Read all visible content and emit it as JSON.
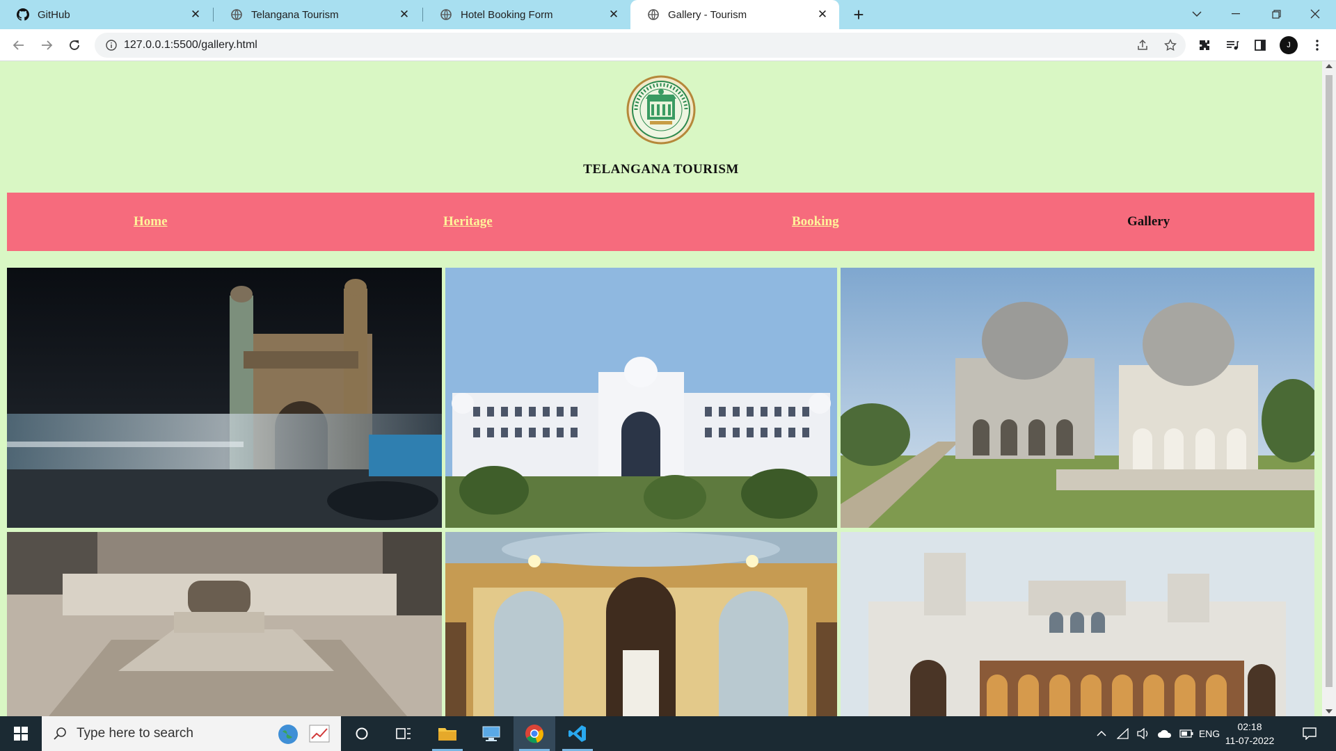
{
  "browser": {
    "tabs": [
      {
        "title": "GitHub",
        "favicon": "github-icon",
        "active": false
      },
      {
        "title": "Telangana Tourism",
        "favicon": "globe-icon",
        "active": false
      },
      {
        "title": "Hotel Booking Form",
        "favicon": "globe-icon",
        "active": false
      },
      {
        "title": "Gallery - Tourism",
        "favicon": "globe-icon",
        "active": true
      }
    ],
    "url": "127.0.0.1:5500/gallery.html",
    "profile_initial": "J"
  },
  "page": {
    "site_title": "TELANGANA TOURISM",
    "logo": "government-of-telangana-seal",
    "nav": [
      {
        "label": "Home",
        "current": false
      },
      {
        "label": "Heritage",
        "current": false
      },
      {
        "label": "Booking",
        "current": false
      },
      {
        "label": "Gallery",
        "current": true
      }
    ],
    "gallery": [
      {
        "subject": "charminar-night"
      },
      {
        "subject": "salar-jung-museum"
      },
      {
        "subject": "qutb-shahi-tombs"
      },
      {
        "subject": "marble-tomb"
      },
      {
        "subject": "palace-interior"
      },
      {
        "subject": "chowmahalla-palace"
      }
    ],
    "colors": {
      "page_bg": "#d9f7c4",
      "navbar_bg": "#f66b7d",
      "nav_link": "#fff39a"
    }
  },
  "taskbar": {
    "search_placeholder": "Type here to search",
    "language": "ENG",
    "time": "02:18",
    "date": "11-07-2022"
  }
}
